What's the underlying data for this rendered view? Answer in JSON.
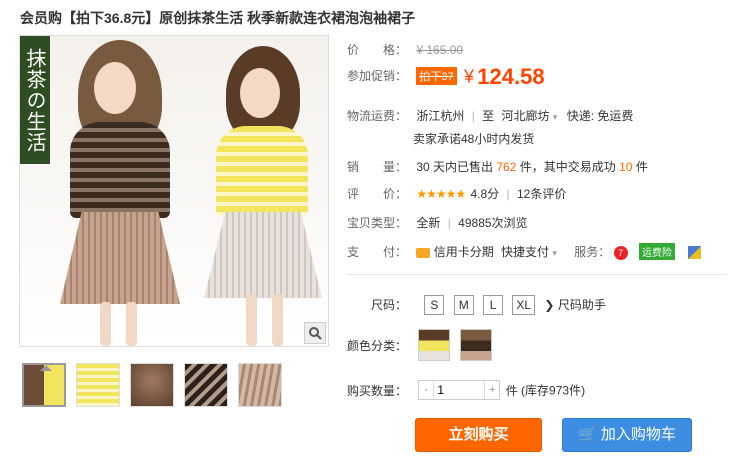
{
  "title": "会员购【拍下36.8元】原创抹茶生活 秋季新款连衣裙泡泡袖裙子",
  "badge_text": "抹茶の生活",
  "price": {
    "label": "价　　格：",
    "original": "¥ 165.00"
  },
  "promo": {
    "label": "参加促销：",
    "tag": "拍下37",
    "yen": "¥",
    "value": "124.58"
  },
  "shipping": {
    "label": "物流运费：",
    "from": "浙江杭州",
    "to_prefix": "至",
    "to": "河北廊坊",
    "express": "快递: 免运费",
    "promise": "卖家承诺48小时内发货"
  },
  "sales": {
    "label": "销　　量：",
    "prefix": "30 天内已售出",
    "count": "762",
    "mid": "件，其中交易成功",
    "success": "10",
    "suffix": "件"
  },
  "rating": {
    "label": "评　　价：",
    "stars": "★★★★★",
    "score": "4.8分",
    "reviews": "12条评价"
  },
  "type": {
    "label": "宝贝类型：",
    "value": "全新",
    "views": "49885次浏览"
  },
  "payment": {
    "label": "支　　付：",
    "credit": "信用卡分期",
    "quick": "快捷支付",
    "services_label": "服务：",
    "insurance": "运费险"
  },
  "size": {
    "label": "尺码：",
    "options": [
      "S",
      "M",
      "L",
      "XL"
    ],
    "helper": "尺码助手"
  },
  "color": {
    "label": "颜色分类："
  },
  "quantity": {
    "label": "购买数量：",
    "minus": "-",
    "value": "1",
    "plus": "+",
    "unit": "件",
    "stock": "(库存973件)"
  },
  "buttons": {
    "buy": "立刻购买",
    "cart": "加入购物车"
  },
  "colors": {
    "accent": "#ff6600",
    "price": "#ff4400",
    "cart": "#3d8ee3",
    "badge": "#2f4d22"
  },
  "icons": [
    "search-icon",
    "star-icon",
    "credit-card-icon",
    "cart-icon"
  ]
}
